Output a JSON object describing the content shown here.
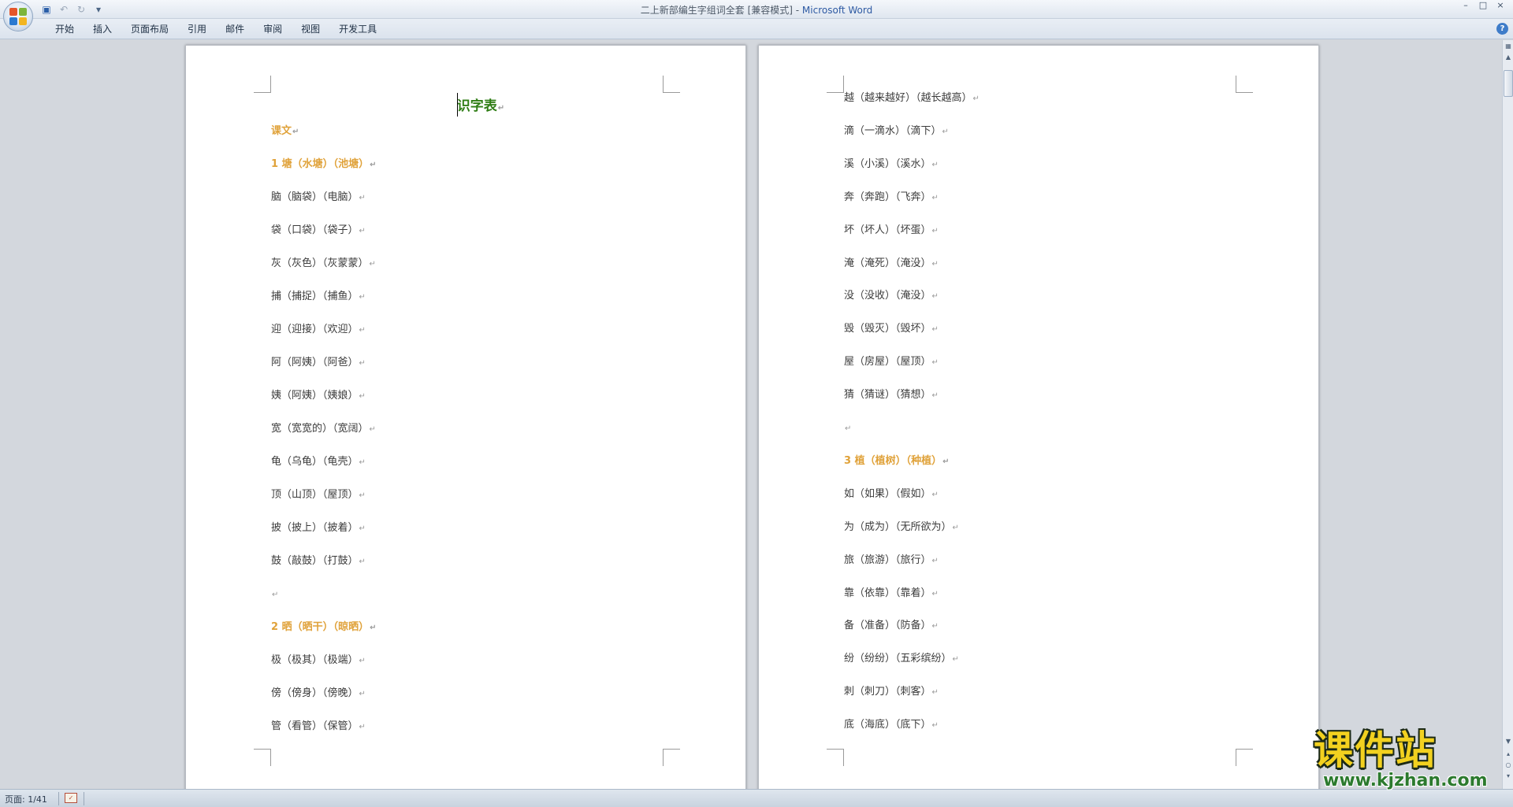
{
  "window": {
    "doc_title": "二上新部编生字组词全套 [兼容模式] - ",
    "app_name": "Microsoft Word",
    "controls": [
      "–",
      "□",
      "×"
    ]
  },
  "quick_access": {
    "save_icon": "save-icon",
    "undo_icon": "undo-icon",
    "redo_icon": "redo-icon",
    "more": "▾"
  },
  "ribbon": {
    "tabs": [
      "开始",
      "插入",
      "页面布局",
      "引用",
      "邮件",
      "审阅",
      "视图",
      "开发工具"
    ],
    "help": "?"
  },
  "document": {
    "left_page": {
      "title": "识字表",
      "lines": [
        {
          "text": "课文",
          "heading": true
        },
        {
          "text": "1 塘（水塘）（池塘）",
          "heading": true
        },
        {
          "text": "脑（脑袋）（电脑）",
          "heading": false
        },
        {
          "text": "袋（口袋）（袋子）",
          "heading": false
        },
        {
          "text": "灰（灰色）（灰蒙蒙）",
          "heading": false
        },
        {
          "text": "捕（捕捉）（捕鱼）",
          "heading": false
        },
        {
          "text": "迎（迎接）（欢迎）",
          "heading": false
        },
        {
          "text": "阿（阿姨）（阿爸）",
          "heading": false
        },
        {
          "text": "姨（阿姨）（姨娘）",
          "heading": false
        },
        {
          "text": "宽（宽宽的）（宽阔）",
          "heading": false
        },
        {
          "text": "龟（乌龟）（龟壳）",
          "heading": false
        },
        {
          "text": "顶（山顶）（屋顶）",
          "heading": false
        },
        {
          "text": "披（披上）（披着）",
          "heading": false
        },
        {
          "text": "鼓（敲鼓）（打鼓）",
          "heading": false
        },
        {
          "text": "",
          "heading": false
        },
        {
          "text": "2 晒（晒干）（晾晒）",
          "heading": true
        },
        {
          "text": "极（极其）（极端）",
          "heading": false
        },
        {
          "text": "傍（傍身）（傍晚）",
          "heading": false
        },
        {
          "text": "管（看管）（保管）",
          "heading": false
        }
      ]
    },
    "right_page": {
      "lines": [
        {
          "text": "越（越来越好）（越长越高）",
          "heading": false
        },
        {
          "text": "滴（一滴水）（滴下）",
          "heading": false
        },
        {
          "text": "溪（小溪）（溪水）",
          "heading": false
        },
        {
          "text": "奔（奔跑）（飞奔）",
          "heading": false
        },
        {
          "text": "坏（坏人）（坏蛋）",
          "heading": false
        },
        {
          "text": "淹（淹死）（淹没）",
          "heading": false
        },
        {
          "text": "没（没收）（淹没）",
          "heading": false
        },
        {
          "text": "毁（毁灭）（毁坏）",
          "heading": false
        },
        {
          "text": "屋（房屋）（屋顶）",
          "heading": false
        },
        {
          "text": "猜（猜谜）（猜想）",
          "heading": false
        },
        {
          "text": "",
          "heading": false
        },
        {
          "text": "3 植（植树）（种植）",
          "heading": true
        },
        {
          "text": "如（如果）（假如）",
          "heading": false
        },
        {
          "text": "为（成为）（无所欲为）",
          "heading": false
        },
        {
          "text": "旅（旅游）（旅行）",
          "heading": false
        },
        {
          "text": "靠（依靠）（靠着）",
          "heading": false
        },
        {
          "text": "备（准备）（防备）",
          "heading": false
        },
        {
          "text": "纷（纷纷）（五彩缤纷）",
          "heading": false
        },
        {
          "text": "刺（刺刀）（刺客）",
          "heading": false
        },
        {
          "text": "底（海底）（底下）",
          "heading": false
        }
      ]
    },
    "paragraph_mark": "↵"
  },
  "status_bar": {
    "page_info": "页面: 1/41"
  },
  "watermark": {
    "name": "课件站",
    "url": "www.kjzhan.com"
  },
  "colors": {
    "heading": "#e0a23a",
    "title": "#2f7d15",
    "body": "#3c3c3c",
    "app_name": "#2e5aa3"
  }
}
